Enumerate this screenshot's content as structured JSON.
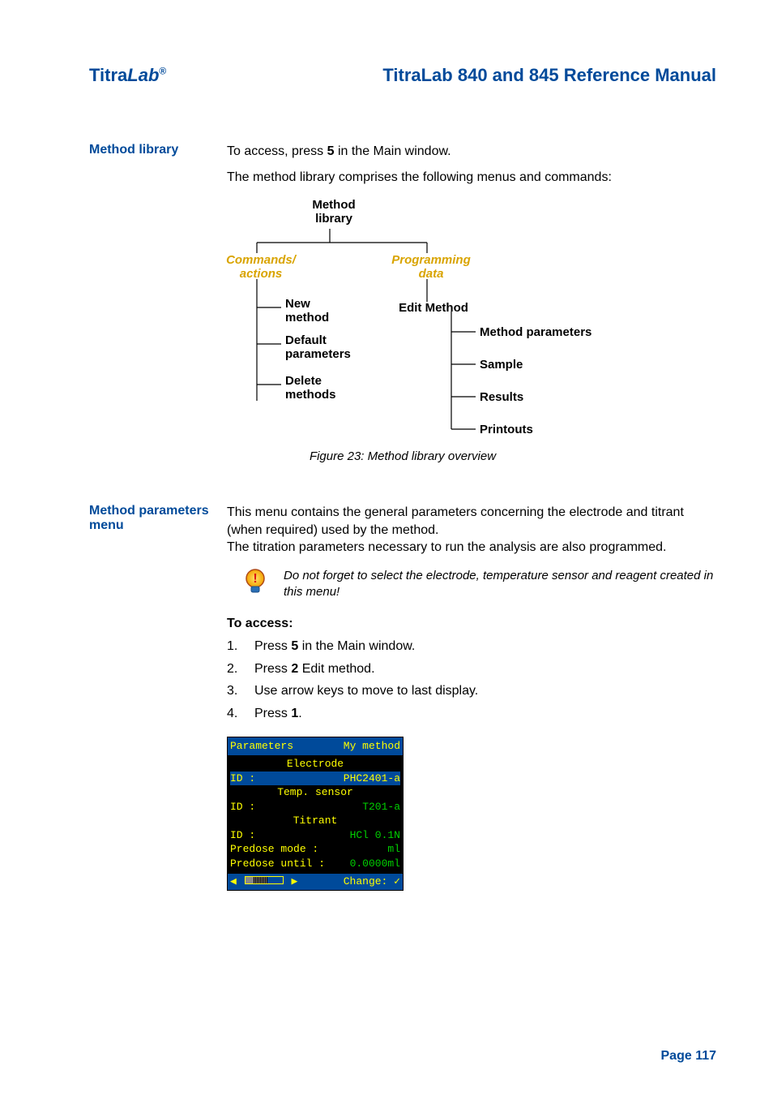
{
  "brand_main": "Titra",
  "brand_sub": "Lab",
  "brand_reg": "®",
  "manual_title": "TitraLab 840 and 845 Reference Manual",
  "s1": {
    "side": "Method library",
    "p1a": "To access, press ",
    "p1b": "5",
    "p1c": " in the Main window.",
    "p2": "The method library comprises the following menus and commands:"
  },
  "diagram": {
    "root": "Method\nlibrary",
    "left_head": "Commands/\nactions",
    "right_head": "Programming\ndata",
    "l1": "New\nmethod",
    "l2": "Default\nparameters",
    "l3": "Delete\nmethods",
    "r_root": "Edit Method",
    "r1": "Method parameters",
    "r2": "Sample",
    "r3": "Results",
    "r4": "Printouts"
  },
  "fig_caption": "Figure 23: Method library overview",
  "s2": {
    "side": "Method parameters menu",
    "p1": "This menu contains the general parameters concerning the electrode and titrant (when required) used by the method.",
    "p2": "The titration parameters necessary to run the analysis are also programmed.",
    "note": "Do not forget to select the electrode, temperature sensor and reagent created in this menu!",
    "access_head": "To access:",
    "steps": {
      "n1": "1.",
      "t1a": "Press ",
      "t1b": "5",
      "t1c": " in the Main window.",
      "n2": "2.",
      "t2a": "Press ",
      "t2b": "2",
      "t2c": " Edit method.",
      "n3": "3.",
      "t3": "Use arrow keys to move to last display.",
      "n4": "4.",
      "t4a": "Press ",
      "t4b": "1",
      "t4c": "."
    }
  },
  "lcd": {
    "title_l": "Parameters",
    "title_r": "My method",
    "sec1": "Electrode",
    "id_label": "ID :",
    "id1_val": "PHC2401-a",
    "sec2": "Temp. sensor",
    "id2_val": "T201-a",
    "sec3": "Titrant",
    "id3_val": "HCl 0.1N",
    "predose_mode_l": "Predose mode :",
    "predose_mode_v": "ml",
    "predose_until_l": "Predose until :",
    "predose_until_v": "0.0000ml",
    "footer_left": "◀",
    "footer_left2": "▶",
    "footer_right": "Change: ✓"
  },
  "page_num": "Page 117"
}
